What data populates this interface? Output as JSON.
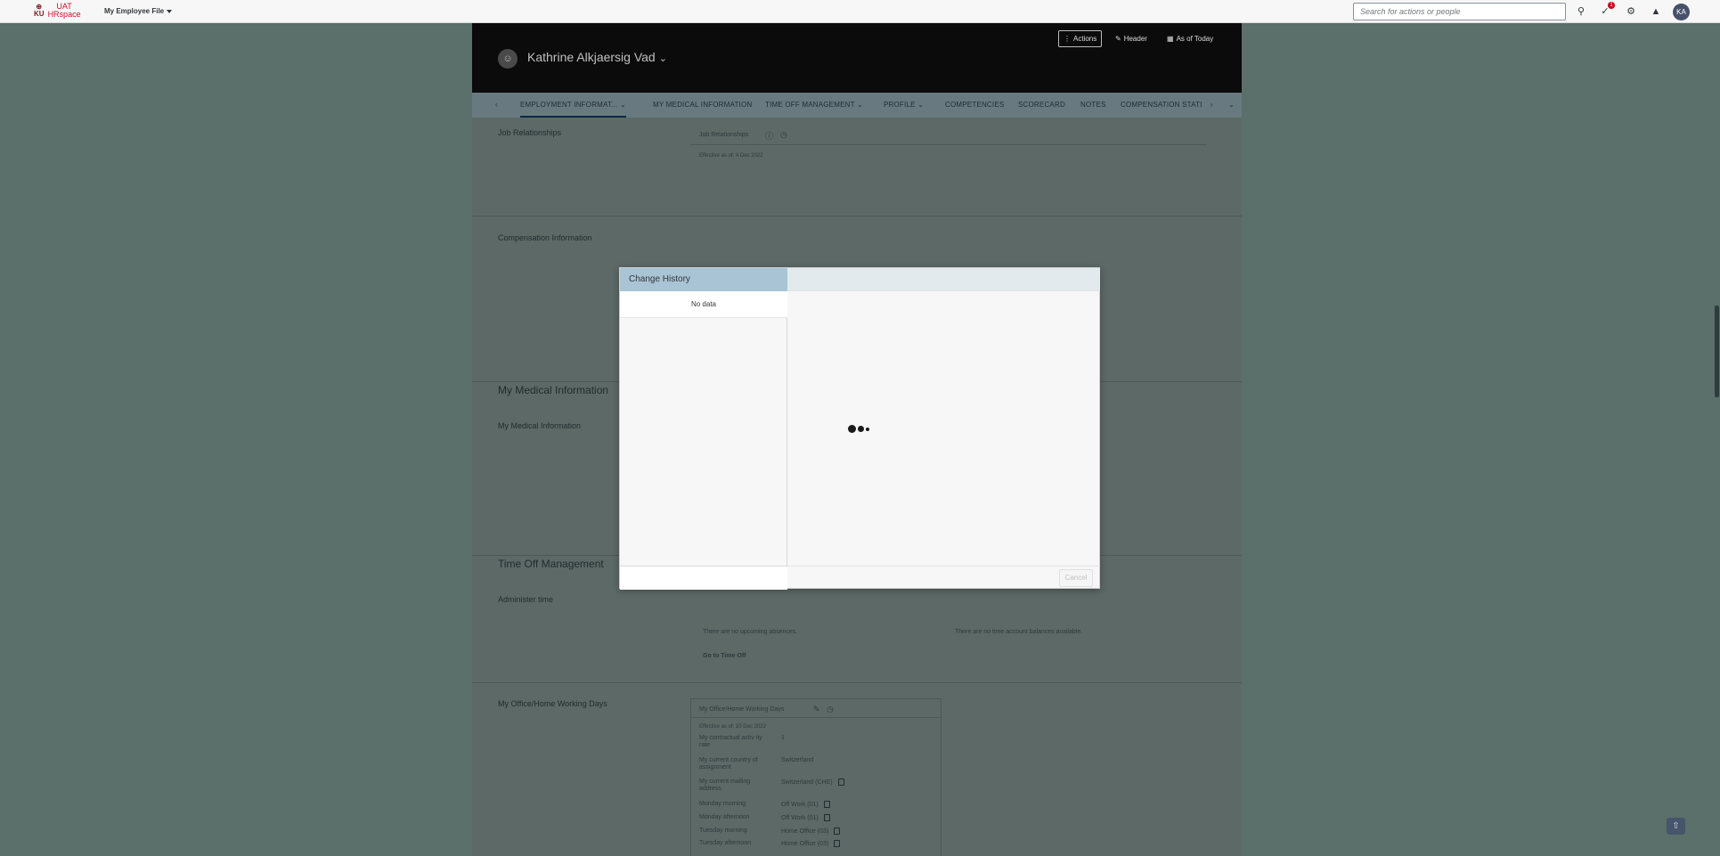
{
  "shell": {
    "logo_ku": "KU",
    "logo_top": "UAT",
    "logo_brand": "HRspace",
    "app_menu": "My Employee File",
    "search_placeholder": "Search for actions or people",
    "notif_count": "1",
    "avatar": "KA"
  },
  "header": {
    "name": "Kathrine Alkjaersig Vad",
    "actions": "Actions",
    "header_btn": "Header",
    "as_of": "As of Today"
  },
  "tabs": [
    "EMPLOYMENT INFORMAT...",
    "MY MEDICAL INFORMATION",
    "TIME OFF MANAGEMENT",
    "PROFILE",
    "COMPETENCIES",
    "SCORECARD",
    "NOTES",
    "COMPENSATION STATI"
  ],
  "sections": {
    "job_rel": "Job Relationships",
    "job_rel_card": "Job Relationships",
    "job_rel_effective": "Effective as of: 4 Dec 2022",
    "comp_info": "Compensation Information",
    "med_title": "My Medical Information",
    "med_sub": "My Medical Information",
    "time_off_title": "Time Off Management",
    "administer": "Administer time",
    "no_absences": "There are no upcoming absences.",
    "no_balances": "There are no time account balances available.",
    "go_time_off": "Go to Time Off",
    "office_days": "My Office/Home Working Days"
  },
  "office_card": {
    "title": "My Office/Home Working Days",
    "effective": "Effective as of: 10 Dec 2022",
    "rows": [
      {
        "label": "My contractual activ ity rate",
        "value": "1"
      },
      {
        "label": "My current country of assignment",
        "value": "Switzerland"
      },
      {
        "label": "My current mailing address",
        "value": "Switzerland (CHE)"
      },
      {
        "label": "Monday morning",
        "value": "Off Work (01)"
      },
      {
        "label": "Monday afternoon",
        "value": "Off Work (01)"
      },
      {
        "label": "Tuesday morning",
        "value": "Home Office (03)"
      },
      {
        "label": "Tuesday afternoon",
        "value": "Home Office (03)"
      }
    ]
  },
  "dialog": {
    "title": "Change History",
    "no_data": "No data",
    "cancel": "Cancel"
  }
}
